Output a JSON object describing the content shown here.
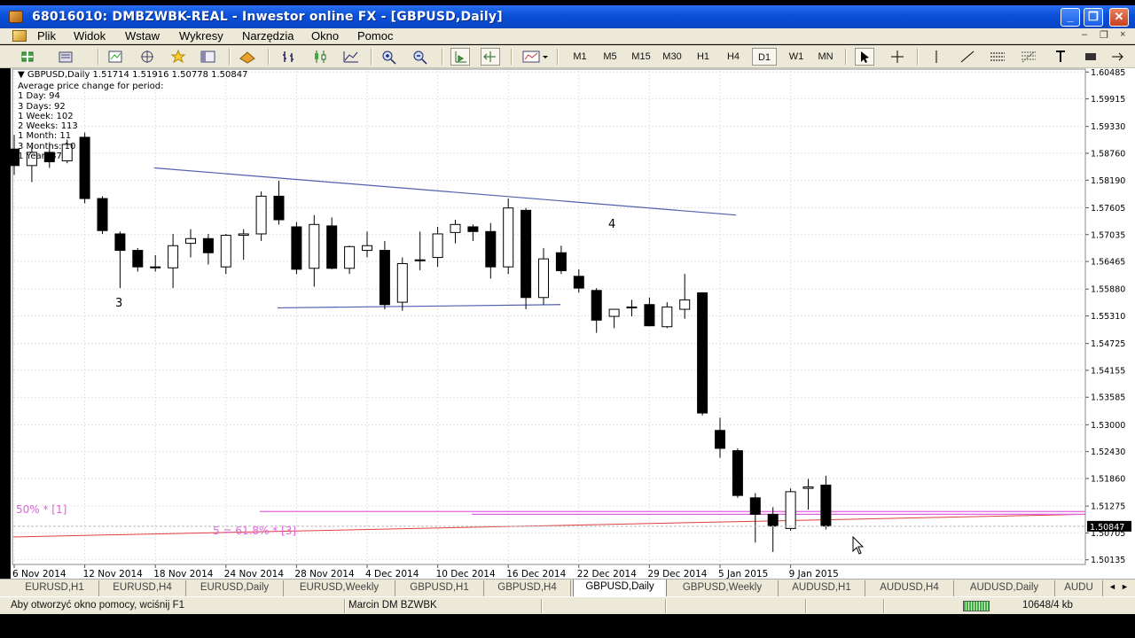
{
  "window": {
    "title": "68016010: DMBZWBK-REAL - Inwestor online FX - [GBPUSD,Daily]",
    "min_glyph": "_",
    "max_glyph": "❐",
    "close_glyph": "✕"
  },
  "menu": {
    "items": [
      "Plik",
      "Widok",
      "Wstaw",
      "Wykresy",
      "Narzędzia",
      "Okno",
      "Pomoc"
    ],
    "mdi_min": "–",
    "mdi_restore": "❐",
    "mdi_close": "×"
  },
  "toolbar": {
    "periods": [
      "M1",
      "M5",
      "M15",
      "M30",
      "H1",
      "H4",
      "D1",
      "W1",
      "MN"
    ],
    "active_period": "D1"
  },
  "chart": {
    "ohlc": "GBPUSD,Daily  1.51714 1.51916 1.50778 1.50847",
    "stats_title": "Average price change for period:",
    "stats": [
      "1 Day: 94",
      "3 Days: 92",
      "1 Week: 102",
      "2 Weeks: 113",
      "1 Month: 11",
      "3 Months: 10",
      "1 Year: 87"
    ],
    "annotation_3": "3",
    "annotation_4": "4",
    "fib_label_1": "50% * [1]",
    "fib_label_2": "5 = 61.8% * [3]",
    "current_price": "1.50847",
    "colors": {
      "trendline": "#5060b0",
      "fib": "#e060e0",
      "ma": "#e04040",
      "price_tag_bg": "#000000"
    }
  },
  "chart_data": {
    "type": "candlestick",
    "symbol": "GBPUSD",
    "timeframe": "Daily",
    "y_ticks": [
      "1.60485",
      "1.59915",
      "1.59330",
      "1.58760",
      "1.58190",
      "1.57605",
      "1.57035",
      "1.56465",
      "1.55880",
      "1.55310",
      "1.54725",
      "1.54155",
      "1.53585",
      "1.53000",
      "1.52430",
      "1.51860",
      "1.51275",
      "1.50705",
      "1.50135"
    ],
    "ylim": [
      1.5013,
      1.6049
    ],
    "x_ticks": [
      "6 Nov 2014",
      "12 Nov 2014",
      "18 Nov 2014",
      "24 Nov 2014",
      "28 Nov 2014",
      "4 Dec 2014",
      "10 Dec 2014",
      "16 Dec 2014",
      "22 Dec 2014",
      "29 Dec 2014",
      "5 Jan 2015",
      "9 Jan 2015"
    ],
    "candles": [
      {
        "o": 1.5885,
        "h": 1.5915,
        "l": 1.583,
        "c": 1.585
      },
      {
        "o": 1.585,
        "h": 1.589,
        "l": 1.5815,
        "c": 1.5878
      },
      {
        "o": 1.5878,
        "h": 1.5895,
        "l": 1.5845,
        "c": 1.5858
      },
      {
        "o": 1.586,
        "h": 1.5905,
        "l": 1.5855,
        "c": 1.5895
      },
      {
        "o": 1.591,
        "h": 1.592,
        "l": 1.577,
        "c": 1.578
      },
      {
        "o": 1.578,
        "h": 1.5785,
        "l": 1.5705,
        "c": 1.5712
      },
      {
        "o": 1.5705,
        "h": 1.571,
        "l": 1.559,
        "c": 1.567
      },
      {
        "o": 1.567,
        "h": 1.5675,
        "l": 1.5625,
        "c": 1.5635
      },
      {
        "o": 1.5635,
        "h": 1.566,
        "l": 1.5625,
        "c": 1.5633
      },
      {
        "o": 1.5633,
        "h": 1.5705,
        "l": 1.559,
        "c": 1.568
      },
      {
        "o": 1.5685,
        "h": 1.5715,
        "l": 1.5655,
        "c": 1.5695
      },
      {
        "o": 1.5695,
        "h": 1.5705,
        "l": 1.564,
        "c": 1.5665
      },
      {
        "o": 1.5635,
        "h": 1.5705,
        "l": 1.562,
        "c": 1.5702
      },
      {
        "o": 1.5702,
        "h": 1.5715,
        "l": 1.565,
        "c": 1.5705
      },
      {
        "o": 1.5705,
        "h": 1.5795,
        "l": 1.569,
        "c": 1.5785
      },
      {
        "o": 1.5785,
        "h": 1.5818,
        "l": 1.5725,
        "c": 1.5735
      },
      {
        "o": 1.572,
        "h": 1.573,
        "l": 1.562,
        "c": 1.563
      },
      {
        "o": 1.5632,
        "h": 1.5745,
        "l": 1.5593,
        "c": 1.5725
      },
      {
        "o": 1.5722,
        "h": 1.574,
        "l": 1.563,
        "c": 1.5632
      },
      {
        "o": 1.5632,
        "h": 1.568,
        "l": 1.562,
        "c": 1.5678
      },
      {
        "o": 1.567,
        "h": 1.571,
        "l": 1.5655,
        "c": 1.568
      },
      {
        "o": 1.567,
        "h": 1.569,
        "l": 1.5545,
        "c": 1.5555
      },
      {
        "o": 1.556,
        "h": 1.5655,
        "l": 1.5542,
        "c": 1.5642
      },
      {
        "o": 1.5648,
        "h": 1.571,
        "l": 1.5628,
        "c": 1.565
      },
      {
        "o": 1.5655,
        "h": 1.572,
        "l": 1.5635,
        "c": 1.5705
      },
      {
        "o": 1.5708,
        "h": 1.5735,
        "l": 1.5685,
        "c": 1.5725
      },
      {
        "o": 1.572,
        "h": 1.5725,
        "l": 1.569,
        "c": 1.571
      },
      {
        "o": 1.571,
        "h": 1.5728,
        "l": 1.561,
        "c": 1.5635
      },
      {
        "o": 1.5635,
        "h": 1.578,
        "l": 1.562,
        "c": 1.576
      },
      {
        "o": 1.5755,
        "h": 1.576,
        "l": 1.5545,
        "c": 1.557
      },
      {
        "o": 1.557,
        "h": 1.5675,
        "l": 1.5555,
        "c": 1.5652
      },
      {
        "o": 1.5665,
        "h": 1.568,
        "l": 1.562,
        "c": 1.5627
      },
      {
        "o": 1.5615,
        "h": 1.563,
        "l": 1.558,
        "c": 1.559
      },
      {
        "o": 1.5585,
        "h": 1.559,
        "l": 1.5495,
        "c": 1.5522
      },
      {
        "o": 1.553,
        "h": 1.5545,
        "l": 1.5505,
        "c": 1.5545
      },
      {
        "o": 1.5548,
        "h": 1.5565,
        "l": 1.553,
        "c": 1.555
      },
      {
        "o": 1.5555,
        "h": 1.557,
        "l": 1.551,
        "c": 1.551
      },
      {
        "o": 1.5508,
        "h": 1.556,
        "l": 1.5505,
        "c": 1.555
      },
      {
        "o": 1.5545,
        "h": 1.562,
        "l": 1.5525,
        "c": 1.5565
      },
      {
        "o": 1.558,
        "h": 1.558,
        "l": 1.532,
        "c": 1.5325
      },
      {
        "o": 1.5288,
        "h": 1.5315,
        "l": 1.523,
        "c": 1.525
      },
      {
        "o": 1.5245,
        "h": 1.525,
        "l": 1.5145,
        "c": 1.515
      },
      {
        "o": 1.5145,
        "h": 1.5155,
        "l": 1.505,
        "c": 1.511
      },
      {
        "o": 1.511,
        "h": 1.5125,
        "l": 1.503,
        "c": 1.5085
      },
      {
        "o": 1.508,
        "h": 1.5165,
        "l": 1.5075,
        "c": 1.5158
      },
      {
        "o": 1.5165,
        "h": 1.5185,
        "l": 1.512,
        "c": 1.5168
      },
      {
        "o": 1.5172,
        "h": 1.5192,
        "l": 1.5078,
        "c": 1.5085
      }
    ]
  },
  "tabs": {
    "items": [
      "EURUSD,H1",
      "EURUSD,H4",
      "EURUSD,Daily",
      "EURUSD,Weekly",
      "GBPUSD,H1",
      "GBPUSD,H4",
      "GBPUSD,Daily",
      "GBPUSD,Weekly",
      "AUDUSD,H1",
      "AUDUSD,H4",
      "AUDUSD,Daily",
      "AUDU"
    ],
    "active": "GBPUSD,Daily",
    "scroll_left": "◄",
    "scroll_right": "►"
  },
  "status": {
    "help": "Aby otworzyć okno pomocy, wciśnij F1",
    "profile": "Marcin DM BZWBK",
    "traffic": "10648/4 kb"
  }
}
